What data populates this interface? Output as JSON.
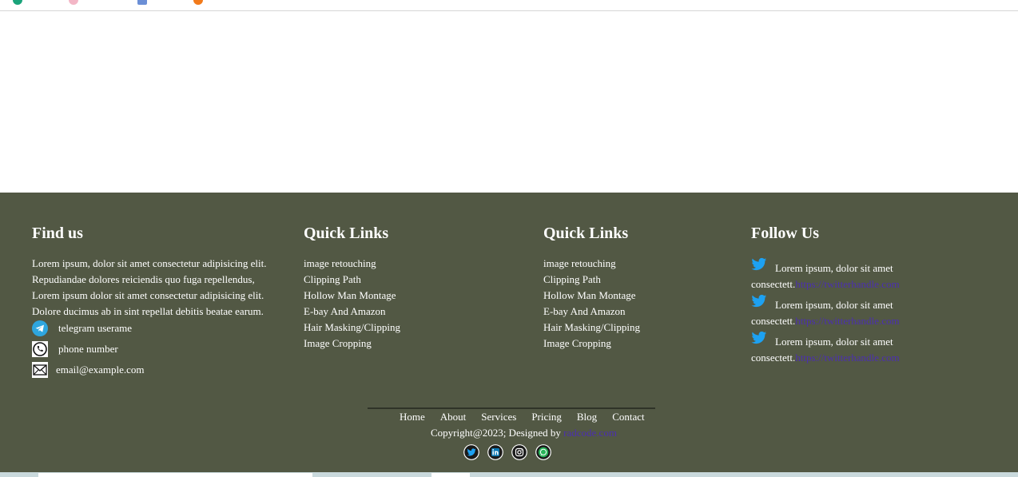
{
  "find_us": {
    "title": "Find us",
    "description": "Lorem ipsum, dolor sit amet consectetur adipisicing elit. Repudiandae dolores reiciendis quo fuga repellendus, Lorem ipsum dolor sit amet consectetur adipisicing elit. Dolore ducimus ab in sint repellat debitis beatae earum.",
    "telegram": "telegram userame",
    "phone": "phone number",
    "email": "email@example.com"
  },
  "quick_links_1": {
    "title": "Quick Links",
    "items": [
      "image retouching",
      "Clipping Path",
      "Hollow Man Montage",
      "E-bay And Amazon",
      "Hair Masking/Clipping",
      "Image Cropping"
    ]
  },
  "quick_links_2": {
    "title": "Quick Links",
    "items": [
      "image retouching",
      "Clipping Path",
      "Hollow Man Montage",
      "E-bay And Amazon",
      "Hair Masking/Clipping",
      "Image Cropping"
    ]
  },
  "follow_us": {
    "title": "Follow Us",
    "items": [
      {
        "text": "Lorem ipsum, dolor sit amet",
        "text2": "consectett.",
        "link": "https://twitterhandle.com"
      },
      {
        "text": "Lorem ipsum, dolor sit amet",
        "text2": "consectett.",
        "link": "https://twitterhandle.com"
      },
      {
        "text": "Lorem ipsum, dolor sit amet",
        "text2": "consectett.",
        "link": "https://twitterhandle.com"
      }
    ]
  },
  "nav": [
    "Home",
    "About",
    "Services",
    "Pricing",
    "Blog",
    "Contact"
  ],
  "copyright": {
    "text": "Copyright@2023; Designed by",
    "link": "radcode.com"
  },
  "colors": {
    "footer_bg": "#525844",
    "link": "#4b2fb0",
    "twitter": "#1da1f2"
  },
  "social_icons": [
    "twitter-icon",
    "linkedin-icon",
    "instagram-icon",
    "whatsapp-icon"
  ]
}
